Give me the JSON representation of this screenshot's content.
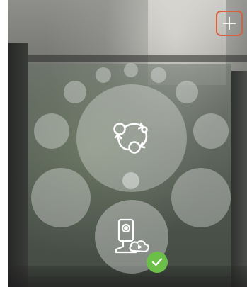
{
  "screen": {
    "add_button_icon": "plus-icon",
    "center_icon": "sync-cycle-icon",
    "camera_icon": "camera-cloud-icon",
    "status_icon": "checkmark-icon"
  },
  "colors": {
    "add_button_border": "#d8603f",
    "check_badge": "#6cc04a",
    "icon_stroke": "#ffffff"
  }
}
